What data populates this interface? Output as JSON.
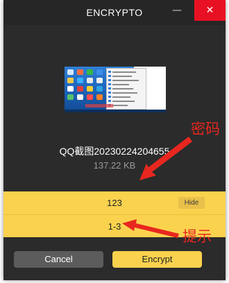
{
  "window": {
    "title": "ENCRYPTO",
    "minimize_glyph": "—",
    "close_glyph": "✕"
  },
  "file": {
    "name": "QQ截图20230224204655",
    "size": "137.22 KB"
  },
  "password": {
    "value": "123",
    "hide_label": "Hide",
    "hint": "1-3"
  },
  "buttons": {
    "cancel_label": "Cancel",
    "encrypt_label": "Encrypt"
  },
  "annotations": {
    "password_label": "密码",
    "hint_label": "提示",
    "color": "#e8271f"
  },
  "colors": {
    "window_bg": "#2b2b2b",
    "accent_yellow": "#fbd24e",
    "close_red": "#e81123"
  }
}
